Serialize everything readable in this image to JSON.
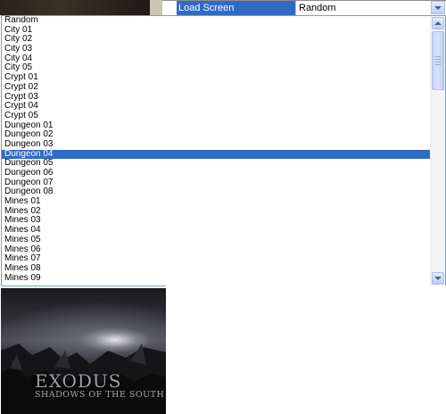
{
  "property_row": {
    "label": "Load Screen",
    "value": "Random"
  },
  "list": {
    "selected_index": 14,
    "items": [
      "Random",
      "City 01",
      "City 02",
      "City 03",
      "City 04",
      "City 05",
      "Crypt 01",
      "Crypt 02",
      "Crypt 03",
      "Crypt 04",
      "Crypt 05",
      "Dungeon 01",
      "Dungeon 02",
      "Dungeon 03",
      "Dungeon 04",
      "Dungeon 05",
      "Dungeon 06",
      "Dungeon 07",
      "Dungeon 08",
      "Mines 01",
      "Mines 02",
      "Mines 03",
      "Mines 04",
      "Mines 05",
      "Mines 06",
      "Mines 07",
      "Mines 08",
      "Mines 09"
    ]
  },
  "preview": {
    "title": "EXODUS",
    "subtitle": "SHADOWS OF THE SOUTH"
  },
  "colors": {
    "selection": "#316ac5",
    "list_border": "#7f9db9"
  }
}
